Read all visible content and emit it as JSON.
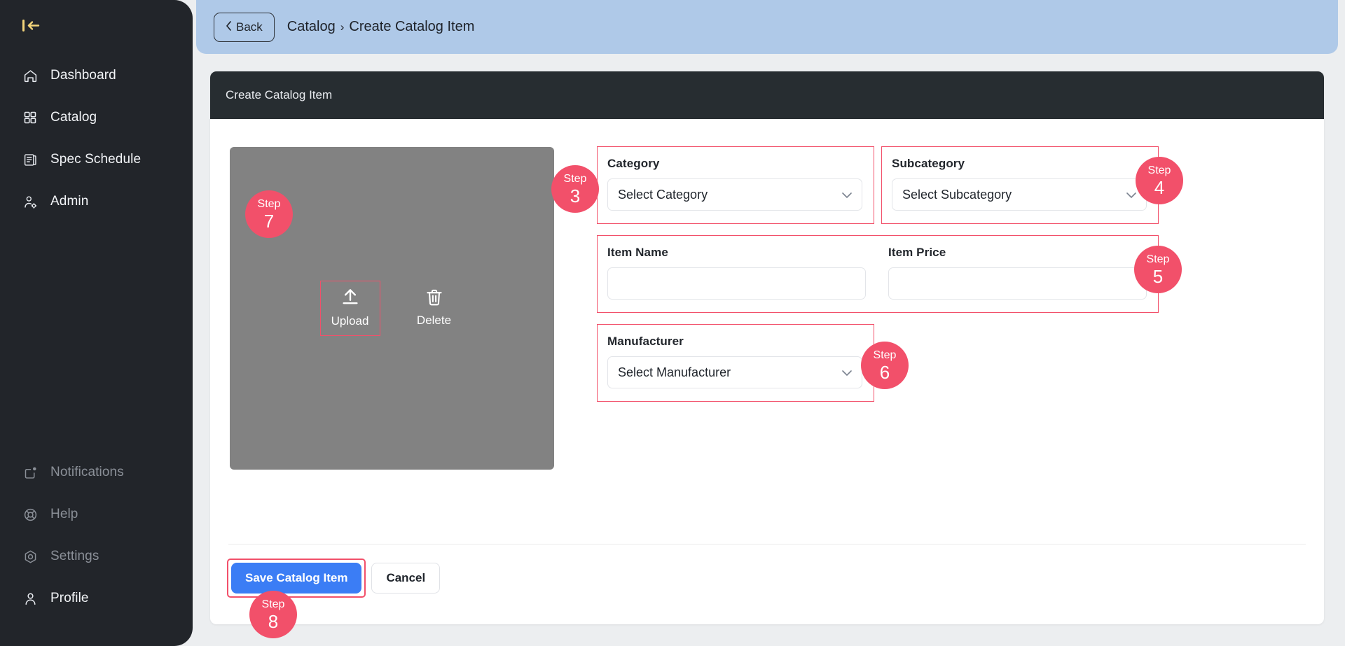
{
  "sidebar": {
    "collapse_icon": "collapse-panel-icon",
    "top_items": [
      {
        "label": "Dashboard",
        "icon": "home-icon",
        "active": true
      },
      {
        "label": "Catalog",
        "icon": "grid-icon",
        "active": true
      },
      {
        "label": "Spec Schedule",
        "icon": "document-list-icon",
        "active": true
      },
      {
        "label": "Admin",
        "icon": "user-gear-icon",
        "active": true
      }
    ],
    "bottom_items": [
      {
        "label": "Notifications",
        "icon": "notification-bell-icon",
        "active": false
      },
      {
        "label": "Help",
        "icon": "life-ring-icon",
        "active": false
      },
      {
        "label": "Settings",
        "icon": "gear-hex-icon",
        "active": false
      },
      {
        "label": "Profile",
        "icon": "user-icon",
        "active": true
      }
    ]
  },
  "topbar": {
    "back_label": "Back",
    "back_icon": "chevron-left-icon",
    "breadcrumb": {
      "parent": "Catalog",
      "separator": "›",
      "current": "Create Catalog Item"
    }
  },
  "card": {
    "title": "Create Catalog Item"
  },
  "image_panel": {
    "upload": {
      "label": "Upload",
      "icon": "upload-arrow-icon"
    },
    "delete": {
      "label": "Delete",
      "icon": "trash-icon"
    }
  },
  "form": {
    "category": {
      "label": "Category",
      "value": "Select Category",
      "icon": "chevron-down-icon"
    },
    "subcategory": {
      "label": "Subcategory",
      "value": "Select Subcategory",
      "icon": "chevron-down-icon"
    },
    "item_name": {
      "label": "Item Name",
      "value": "",
      "placeholder": ""
    },
    "item_price": {
      "label": "Item Price",
      "value": "",
      "placeholder": ""
    },
    "manufacturer": {
      "label": "Manufacturer",
      "value": "Select Manufacturer",
      "icon": "chevron-down-icon"
    }
  },
  "footer": {
    "save_label": "Save Catalog Item",
    "cancel_label": "Cancel"
  },
  "steps": {
    "word": "Step",
    "n3": "3",
    "n4": "4",
    "n5": "5",
    "n6": "6",
    "n7": "7",
    "n8": "8"
  },
  "colors": {
    "sidebar_bg": "#22252a",
    "topbar_bg": "#afc9e8",
    "card_head_bg": "#272d31",
    "accent_step": "#f2506a",
    "primary_button": "#3b7df5",
    "image_placeholder": "#828282",
    "collapse_icon": "#f2d47a"
  }
}
